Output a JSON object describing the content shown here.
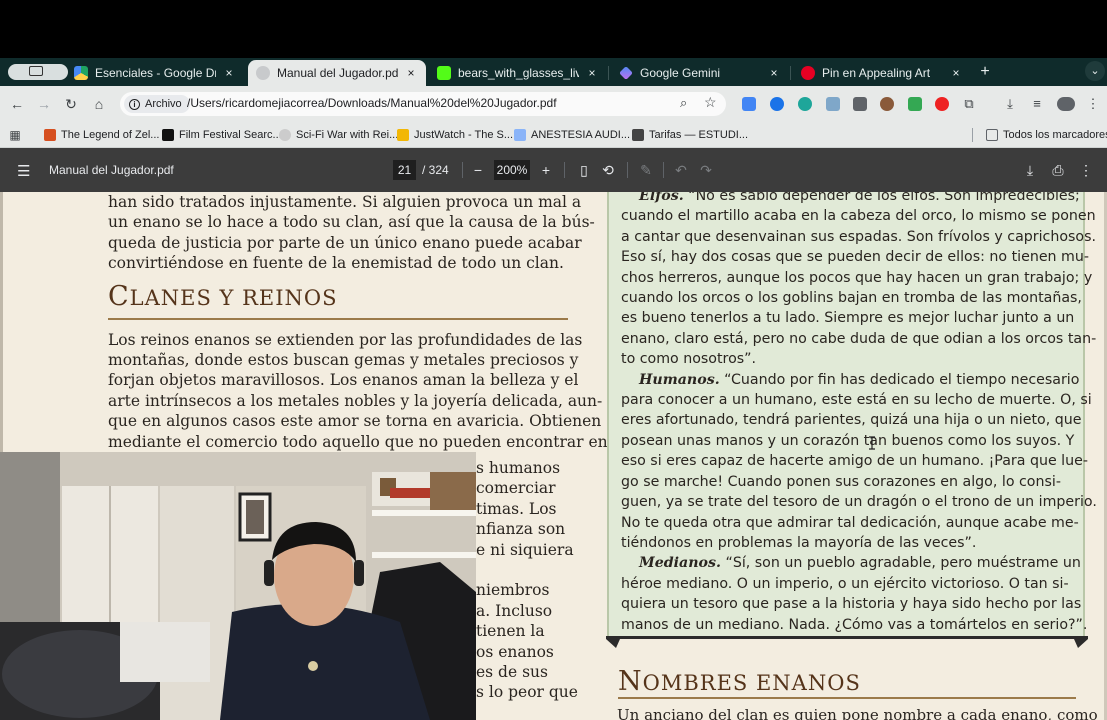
{
  "tabs": [
    {
      "title": "Esenciales - Google Drive",
      "favicon_color": "#1fa463",
      "active": false
    },
    {
      "title": "Manual del Jugador.pdf",
      "favicon_color": "#9aa0a6",
      "active": true
    },
    {
      "title": "bears_with_glasses_live Stre",
      "favicon_color": "#53fc18",
      "active": false
    },
    {
      "title": "Google Gemini",
      "favicon_color": "#7b8ff5",
      "active": false
    },
    {
      "title": "Pin en Appealing Art",
      "favicon_color": "#e60023",
      "active": false
    }
  ],
  "tab_close": "×",
  "new_tab": "+",
  "address_bar": {
    "chip": "Archivo",
    "url": "/Users/ricardomejiacorrea/Downloads/Manual%20del%20Jugador.pdf"
  },
  "bookmarks": [
    {
      "label": "The Legend of Zel...",
      "color": "#d64f1f"
    },
    {
      "label": "Film Festival Searc...",
      "color": "#111111"
    },
    {
      "label": "Sci-Fi War with Rei...",
      "color": "#cccccc"
    },
    {
      "label": "JustWatch - The S...",
      "color": "#f2b705"
    },
    {
      "label": "ANESTESIA AUDI...",
      "color": "#8ab4f8"
    },
    {
      "label": "Tarifas — ESTUDI...",
      "color": "#444444"
    }
  ],
  "bookmarks_all": "Todos los marcadores",
  "pdf_toolbar": {
    "filename": "Manual del Jugador.pdf",
    "page": "21",
    "page_total": "/ 324",
    "zoom": "200%"
  },
  "document": {
    "left_lines_top": [
      "han sido tratados injustamente. Si alguien provoca un mal a",
      "un enano se lo hace a todo su clan, así que la causa de la bús-",
      "queda de justicia por parte de un único enano puede acabar",
      "convirtiéndose en fuente de la enemistad de todo un clan."
    ],
    "heading_initial": "C",
    "heading_rest": "LANES Y REINOS",
    "left_lines_main": [
      "Los reinos enanos se extienden por las profundidades de las",
      "montañas, donde estos buscan gemas y metales preciosos y",
      "forjan objetos maravillosos. Los enanos aman la belleza y el",
      "arte intrínsecos a los metales nobles y la joyería delicada, aun-",
      "que en algunos casos este amor se torna en avaricia. Obtienen",
      "mediante el comercio todo aquello que no pueden encontrar en"
    ],
    "left_fragments": [
      "s humanos",
      "comerciar",
      "timas. Los",
      "nfianza son",
      "e ni siquiera",
      "",
      "niembros",
      "a. Incluso",
      "tienen la",
      "os enanos",
      "es de sus",
      "s lo peor que"
    ],
    "sidebar_lines": [
      {
        "label": "Elfos.",
        "text": " “No es sabio depender de los elfos. Son impredecibles;"
      },
      {
        "label": "",
        "text": "cuando el martillo acaba en la cabeza del orco, lo mismo se ponen"
      },
      {
        "label": "",
        "text": "a cantar que desenvainan sus espadas. Son frívolos y caprichosos."
      },
      {
        "label": "",
        "text": "Eso sí, hay dos cosas que se pueden decir de ellos: no tienen mu-"
      },
      {
        "label": "",
        "text": "chos herreros, aunque los pocos que hay hacen un gran trabajo; y"
      },
      {
        "label": "",
        "text": "cuando los orcos o los goblins bajan en tromba de las montañas,"
      },
      {
        "label": "",
        "text": "es bueno tenerlos a tu lado. Siempre es mejor luchar junto a un"
      },
      {
        "label": "",
        "text": "enano, claro está, pero no cabe duda de que odian a los orcos tan-"
      },
      {
        "label": "",
        "text": "to como nosotros”."
      },
      {
        "label": "Humanos.",
        "text": " “Cuando por fin has dedicado el tiempo necesario"
      },
      {
        "label": "",
        "text": "para conocer a un humano, este está en su lecho de muerte. O, si"
      },
      {
        "label": "",
        "text": "eres afortunado, tendrá parientes, quizá una hija o un nieto, que"
      },
      {
        "label": "",
        "text": "posean unas manos y un corazón tan buenos como los suyos. Y"
      },
      {
        "label": "",
        "text": "eso si eres capaz de hacerte amigo de un humano. ¡Para que lue-"
      },
      {
        "label": "",
        "text": "go se marche! Cuando ponen sus corazones en algo, lo consi-"
      },
      {
        "label": "",
        "text": "guen, ya se trate del tesoro de un dragón o el trono de un imperio."
      },
      {
        "label": "",
        "text": "No te queda otra que admirar tal dedicación, aunque acabe me-"
      },
      {
        "label": "",
        "text": "tiéndonos en problemas la mayoría de las veces”."
      },
      {
        "label": "Medianos.",
        "text": " “Sí, son un pueblo agradable, pero muéstrame un"
      },
      {
        "label": "",
        "text": "héroe mediano. O un imperio, o un ejército victorioso. O tan si-"
      },
      {
        "label": "",
        "text": "quiera un tesoro que pase a la historia y haya sido hecho por las"
      },
      {
        "label": "",
        "text": "manos de un mediano. Nada. ¿Cómo vas a tomártelos en serio?”."
      }
    ],
    "right_heading_initial": "N",
    "right_heading_rest": "OMBRES ENANOS",
    "right_para": "Un anciano del clan es quien pone nombre a cada enano, como"
  },
  "icons": {
    "back": "back-arrow-icon",
    "forward": "forward-arrow-icon",
    "reload": "reload-icon",
    "home": "home-icon"
  }
}
